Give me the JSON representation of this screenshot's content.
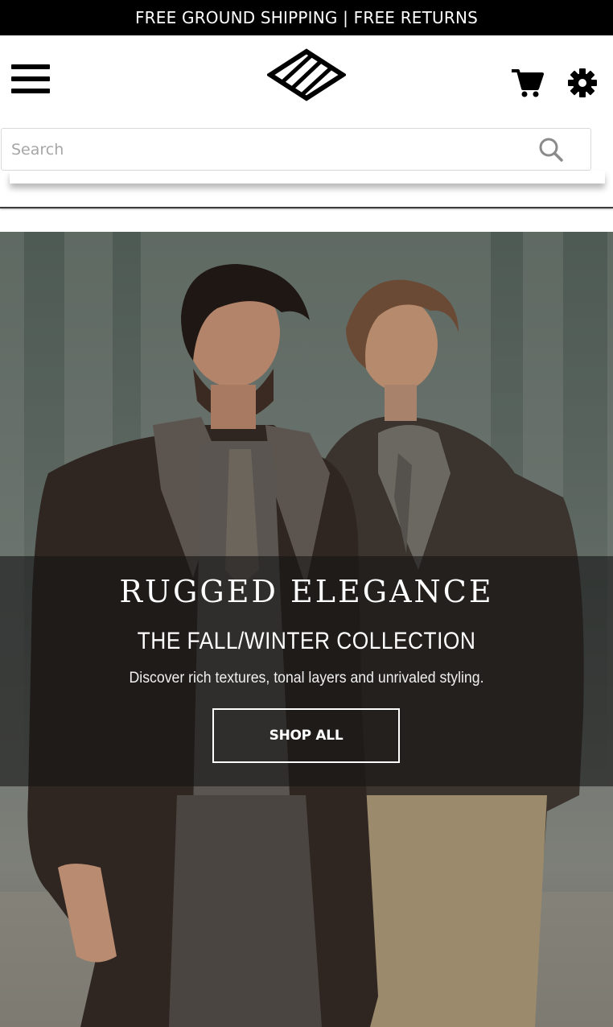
{
  "promo": {
    "text": "FREE GROUND SHIPPING | FREE RETURNS"
  },
  "header": {
    "menu_icon": "hamburger-menu-icon",
    "logo": "diamond-stripes-logo",
    "cart_icon": "shopping-cart-icon",
    "settings_icon": "gear-icon"
  },
  "search": {
    "placeholder": "Search",
    "value": "",
    "icon": "search-icon"
  },
  "hero": {
    "title": "RUGGED ELEGANCE",
    "subtitle": "THE FALL/WINTER COLLECTION",
    "description": "Discover rich textures, tonal layers and unrivaled styling.",
    "cta_label": "SHOP ALL"
  },
  "colors": {
    "promo_background": "#000000",
    "promo_text": "#ffffff",
    "icon": "#000000",
    "overlay": "#141414",
    "cta_border": "#ffffff"
  }
}
